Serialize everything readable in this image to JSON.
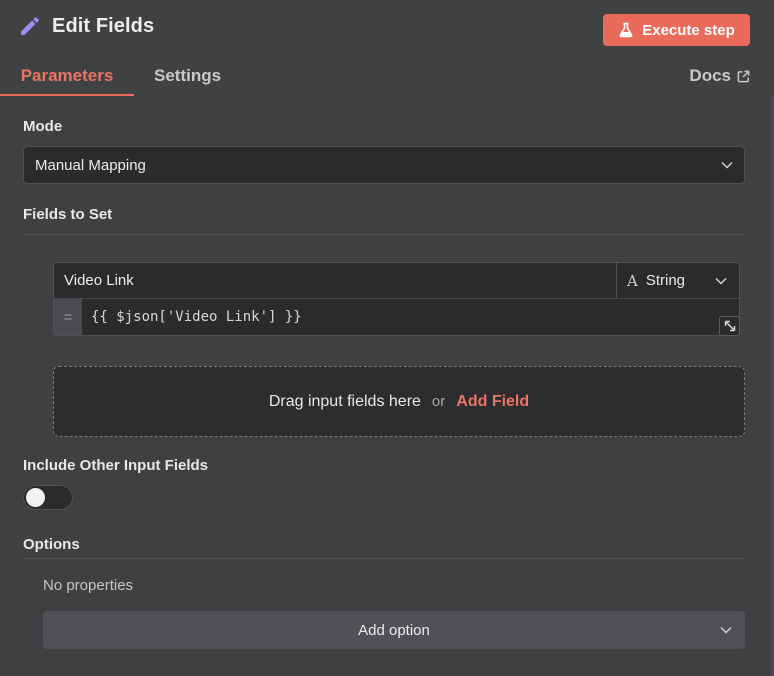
{
  "header": {
    "title": "Edit Fields",
    "title_icon": "pencil-icon",
    "execute_label": "Execute step",
    "execute_icon": "flask-icon",
    "accent_color": "#ea6b5c"
  },
  "tabs": [
    {
      "label": "Parameters",
      "active": true
    },
    {
      "label": "Settings",
      "active": false
    }
  ],
  "docs": {
    "label": "Docs",
    "icon": "external-link-icon"
  },
  "mode": {
    "label": "Mode",
    "value": "Manual Mapping"
  },
  "fields_to_set": {
    "label": "Fields to Set",
    "fields": [
      {
        "name": "Video Link",
        "type": "String",
        "type_icon": "text-type-icon",
        "value": "{{ $json['Video Link'] }}",
        "expression_prefix": "="
      }
    ],
    "drop_zone": {
      "text": "Drag input fields here",
      "or": "or",
      "add_label": "Add Field"
    }
  },
  "include_other": {
    "label": "Include Other Input Fields",
    "enabled": false
  },
  "options": {
    "label": "Options",
    "empty_text": "No properties",
    "add_label": "Add option"
  }
}
